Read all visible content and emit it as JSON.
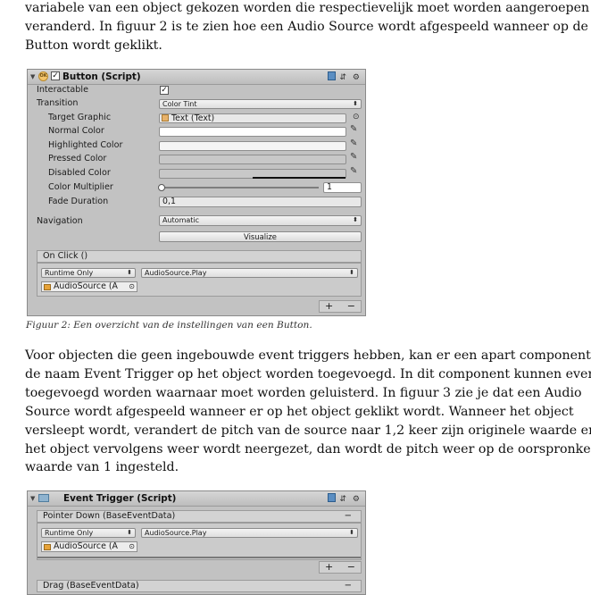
{
  "text": {
    "para1": [
      "variabele van een object gekozen worden die respectievelijk moet worden aangeroepen of",
      "veranderd. In figuur 2 is te zien hoe een Audio Source wordt afgespeeld wanneer op de",
      "Button wordt geklikt."
    ],
    "caption": "Figuur 2: Een overzicht van de instellingen van een Button.",
    "para2": [
      "Voor objecten die geen ingebouwde event triggers hebben, kan er een apart component met",
      "de naam Event Trigger op het object worden toegevoegd. In dit component kunnen events",
      "toegevoegd worden waarnaar moet worden geluisterd. In figuur 3 zie je dat een Audio",
      "Source wordt afgespeeld wanneer er op het object geklikt wordt. Wanneer het object",
      "versleept wordt, verandert de pitch van de source naar 1,2 keer zijn originele waarde en als",
      "het object vervolgens weer wordt neergezet, dan wordt de pitch weer op de oorspronkelijke",
      "waarde van 1 ingesteld."
    ]
  },
  "figure2": {
    "header": {
      "title": "Button (Script)",
      "icon_badge": "OK"
    },
    "rows": {
      "interactable": {
        "label": "Interactable",
        "checked": true
      },
      "transition": {
        "label": "Transition",
        "value": "Color Tint"
      },
      "target_graphic": {
        "label": "Target Graphic",
        "value": "Text (Text)"
      },
      "normal_color": {
        "label": "Normal Color"
      },
      "highlighted_color": {
        "label": "Highlighted Color"
      },
      "pressed_color": {
        "label": "Pressed Color"
      },
      "disabled_color": {
        "label": "Disabled Color"
      },
      "color_multiplier": {
        "label": "Color Multiplier",
        "value": "1",
        "slider_fraction": 0
      },
      "fade_duration": {
        "label": "Fade Duration",
        "value": "0,1"
      },
      "navigation": {
        "label": "Navigation",
        "value": "Automatic"
      },
      "visualize": {
        "label": "Visualize"
      }
    },
    "on_click": {
      "title": "On Click ()",
      "mode": "Runtime Only",
      "function": "AudioSource.Play",
      "object": "AudioSource (A"
    },
    "colors": {
      "panel": "#c2c2c2",
      "normal": "#ffffff",
      "highlighted": "#f5f5f5",
      "pressed": "#c8c8c8",
      "disabled": "#c8c8c8"
    }
  },
  "figure3": {
    "header": {
      "title": "Event Trigger (Script)"
    },
    "events": [
      {
        "title": "Pointer Down (BaseEventData)",
        "mode": "Runtime Only",
        "function": "AudioSource.Play",
        "object": "AudioSource (A"
      },
      {
        "title": "Drag (BaseEventData)"
      }
    ]
  },
  "icons": {
    "collapse": "▼",
    "check": "✓",
    "dropdown_arrow": "⬍",
    "target": "⊙",
    "picker": "✎",
    "settings": "⚙",
    "sliders": "⇵"
  }
}
